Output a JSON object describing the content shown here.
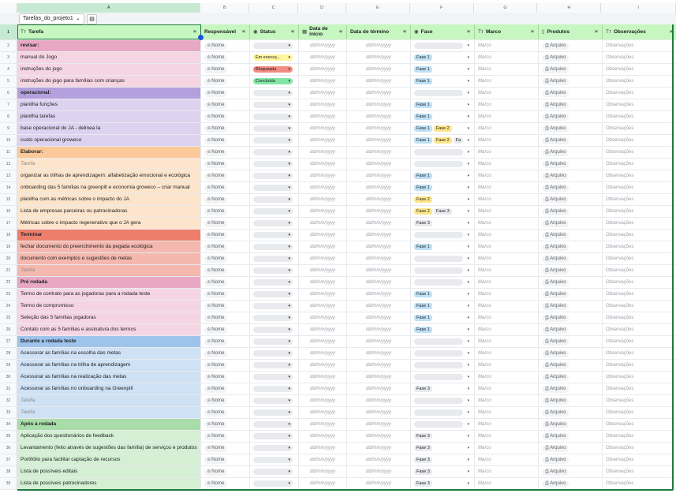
{
  "sheet": {
    "table_name": "Tarefas_do_projeto1",
    "column_letters": [
      "A",
      "B",
      "C",
      "D",
      "E",
      "F",
      "G",
      "H",
      "I"
    ],
    "headers": [
      {
        "label": "Tarefa",
        "icon": "Tт"
      },
      {
        "label": "Responsável",
        "icon": ""
      },
      {
        "label": "Status",
        "icon": "◉"
      },
      {
        "label": "Data de início",
        "icon": "▦"
      },
      {
        "label": "Data de término",
        "icon": ""
      },
      {
        "label": "Fase",
        "icon": "◉"
      },
      {
        "label": "Marco",
        "icon": "Tт"
      },
      {
        "label": "Produtos",
        "icon": "▯"
      },
      {
        "label": "Observações",
        "icon": "Tт"
      }
    ],
    "placeholders": {
      "name": "Nome",
      "date": "dd/mm/yyyy",
      "marco": "Marco",
      "file": "Arquivo",
      "obs": "Observações",
      "task": "Tarefa"
    },
    "colors": {
      "header_green": "#c6f7c0",
      "accent_green": "#1f7a3e"
    },
    "rows": [
      {
        "n": "2",
        "task": "revisar:",
        "group": true,
        "bg": "#e8a8c4"
      },
      {
        "n": "3",
        "task": "manual do Jogo",
        "bg": "#f6d5e2",
        "status": {
          "label": "Em execuç...",
          "color": "#fff59d"
        },
        "phases": [
          "Fase 1"
        ]
      },
      {
        "n": "4",
        "task": "instruções do jogo",
        "bg": "#f6d5e2",
        "status": {
          "label": "Bloqueada",
          "color": "#f28b82"
        },
        "phases": [
          "Fase 1"
        ]
      },
      {
        "n": "5",
        "task": "instruções do jogo para famílias com crianças",
        "bg": "#f6d5e2",
        "status": {
          "label": "Concluída",
          "color": "#81e6a4"
        },
        "phases": [
          "Fase 1"
        ]
      },
      {
        "n": "6",
        "task": "operacional:",
        "group": true,
        "bg": "#b4a0dd"
      },
      {
        "n": "7",
        "task": "planilha funções",
        "bg": "#ddd3f0",
        "phases": [
          "Fase 1"
        ]
      },
      {
        "n": "8",
        "task": "planilha tarefas",
        "bg": "#ddd3f0",
        "phases": [
          "Fase 1"
        ]
      },
      {
        "n": "9",
        "task": "base operacional do JA - delinea la",
        "bg": "#ddd3f0",
        "phases": [
          "Fase 1",
          "Fase 2"
        ]
      },
      {
        "n": "10",
        "task": "custo operacional groweco",
        "bg": "#ddd3f0",
        "phases": [
          "Fase 1",
          "Fase 2",
          "Fa"
        ]
      },
      {
        "n": "11",
        "task": "Elaborar:",
        "group": true,
        "bg": "#fbc99a"
      },
      {
        "n": "12",
        "task": "Tarefa",
        "placeholder": true,
        "bg": "#fde5cc"
      },
      {
        "n": "13",
        "task": "organizar as trilhas de aprendizagem: alfabetização emocional e ecológica",
        "bg": "#fde5cc",
        "phases": [
          "Fase 1"
        ]
      },
      {
        "n": "14",
        "task": "onboarding das 5 famílias na greenpill e economia groweco – criar manual",
        "bg": "#fde5cc",
        "phases": [
          "Fase 1"
        ]
      },
      {
        "n": "15",
        "task": "planilha com as métricas sobre o impacto do JA",
        "bg": "#fde5cc",
        "phases": [
          "Fase 2"
        ]
      },
      {
        "n": "16",
        "task": "Lista de empresas parceiras ou patrocinadoras",
        "bg": "#fde5cc",
        "phases": [
          "Fase 2",
          "Fase 3"
        ]
      },
      {
        "n": "17",
        "task": "Métricas sobre o impacto regenerativo que o JA gera",
        "bg": "#fde5cc",
        "phases": [
          "Fase 3"
        ]
      },
      {
        "n": "18",
        "task": "Terminar",
        "group": true,
        "bg": "#ee7e6c"
      },
      {
        "n": "19",
        "task": "fechar documento do preenchimento da pegada ecológica",
        "bg": "#f5b8ae",
        "phases": [
          "Fase 1"
        ]
      },
      {
        "n": "20",
        "task": "documento com exemplos e sugestões de metas",
        "bg": "#f5b8ae"
      },
      {
        "n": "21",
        "task": "Tarefa",
        "placeholder": true,
        "bg": "#f5b8ae"
      },
      {
        "n": "22",
        "task": "Pré rodada",
        "group": true,
        "bg": "#e8a8c4"
      },
      {
        "n": "23",
        "task": "Termo de contrato para as jogadoras para a rodada teste",
        "bg": "#f6d5e2",
        "phases": [
          "Fase 1"
        ]
      },
      {
        "n": "24",
        "task": "Termo de compromisso",
        "bg": "#f6d5e2",
        "phases": [
          "Fase 1"
        ]
      },
      {
        "n": "25",
        "task": "Seleção das 5 famílias jogadoras",
        "bg": "#f6d5e2",
        "phases": [
          "Fase 1"
        ]
      },
      {
        "n": "26",
        "task": "Contato com as 5 famílias e assinatura dos termos",
        "bg": "#f6d5e2",
        "phases": [
          "Fase 1"
        ]
      },
      {
        "n": "27",
        "task": "Durante a rodada teste",
        "group": true,
        "bg": "#9ec4ec"
      },
      {
        "n": "28",
        "task": "Acessorar as famílias na escolha das metas",
        "bg": "#cfe1f5"
      },
      {
        "n": "29",
        "task": "Acessorar as famílias na trilha de aprendizagem",
        "bg": "#cfe1f5"
      },
      {
        "n": "30",
        "task": "Acessorar as famílias na realização das metas",
        "bg": "#cfe1f5"
      },
      {
        "n": "31",
        "task": "Acessorar as famílias no onboarding na Greenpill",
        "bg": "#cfe1f5",
        "phases": [
          "Fase 3"
        ]
      },
      {
        "n": "32",
        "task": "Tarefa",
        "placeholder": true,
        "bg": "#cfe1f5"
      },
      {
        "n": "33",
        "task": "Tarefa",
        "placeholder": true,
        "bg": "#cfe1f5"
      },
      {
        "n": "34",
        "task": "Após a rodada",
        "group": true,
        "bg": "#a8dca8"
      },
      {
        "n": "35",
        "task": "Aplicação dos questionários de feedback",
        "bg": "#d4efd4",
        "phases": [
          "Fase 3"
        ]
      },
      {
        "n": "36",
        "task": "Levantamento (feito através de sugestões das família) de serviços e produtos",
        "bg": "#d4efd4",
        "phases": [
          "Fase 3"
        ]
      },
      {
        "n": "37",
        "task": "Portifólio para facilitar captação de recursos",
        "bg": "#d4efd4",
        "phases": [
          "Fase 3"
        ]
      },
      {
        "n": "38",
        "task": "Lista de possíveis editais",
        "bg": "#d4efd4",
        "phases": [
          "Fase 3"
        ]
      },
      {
        "n": "39",
        "task": "Lista de possíveis patrocinadores",
        "bg": "#d4efd4",
        "phases": [
          "Fase 3"
        ]
      }
    ],
    "phase_colors": {
      "Fase 1": "#bfe0f5",
      "Fase 2": "#fde68a",
      "Fase 3": "#e8eaed",
      "Fa": "#e8eaed"
    }
  }
}
